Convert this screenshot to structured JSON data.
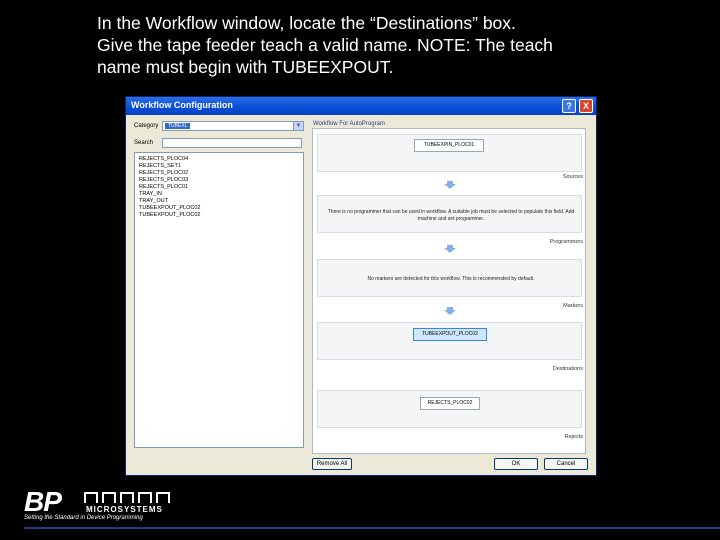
{
  "instruction": {
    "line1": "In the Workflow window, locate the “Destinations” box.",
    "line2": "Give the tape feeder teach a valid name. NOTE: The teach",
    "line3": "name must begin with TUBEEXPOUT."
  },
  "dialog": {
    "title": "Workflow Configuration",
    "help_label": "?",
    "close_label": "X",
    "category_label": "Category",
    "category_value": "TUBEXL",
    "search_label": "Search",
    "list_items": [
      "REJECTS_PLOC04",
      "REJECTS_SET1",
      "REJECTS_PLOC02",
      "REJECTS_PLOC03",
      "REJECTS_PLOC01",
      "TRAY_IN",
      "TRAY_OUT",
      "TUBEEXPOUT_PLOC02",
      "TUBEEXPOUT_PLOC02"
    ],
    "workflow_title": "Workflow For AutoProgram",
    "sources": {
      "chip": "TUBEEXPIN_PLOC01",
      "label": "Sources"
    },
    "programmers": {
      "desc": "There is no programmer that can be used in workflow. A suitable job must be selected to populate this field. Add machine and set programmer.",
      "label": "Programmers"
    },
    "markers": {
      "desc": "No markers are detected for this workflow. This is recommended by default.",
      "label": "Markers"
    },
    "destinations": {
      "chip": "TUBEEXPOUT_PLOC02",
      "label": "Destinations"
    },
    "rejects": {
      "chip": "REJECTS_PLOC02",
      "label": "Rejects"
    },
    "remove_all_label": "Remove All",
    "ok_label": "OK",
    "cancel_label": "Cancel"
  },
  "footer": {
    "logo_text": "BP",
    "brand_text": "MICROSYSTEMS",
    "tagline": "Setting the Standard in Device Programming"
  },
  "colors": {
    "titlebar": "#0a4fd6",
    "background": "#000000",
    "footer_line": "#1e3a8a",
    "selected_chip": "#cfe8ff"
  }
}
